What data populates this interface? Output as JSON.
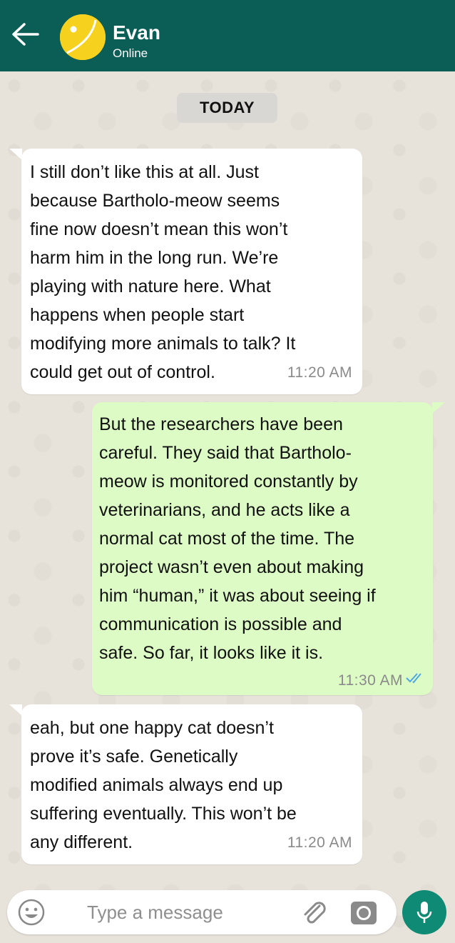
{
  "header": {
    "contact_name": "Evan",
    "status": "Online",
    "background_color": "#0b5e55",
    "avatar_color": "#f6d21f"
  },
  "chat": {
    "date_separator": "TODAY",
    "messages": [
      {
        "direction": "incoming",
        "text": "I still don’t like this at all. Just\nbecause Bartholo-meow seems\nfine now doesn’t mean this won’t\nharm him in the long run. We’re\nplaying with nature here. What\nhappens when people start\nmodifying more animals to talk? It\ncould get out of control.",
        "time": "11:20 AM"
      },
      {
        "direction": "outgoing",
        "text": "But the researchers have been\ncareful. They said that Bartholo-\nmeow is monitored constantly by\nveterinarians, and he acts like a\nnormal cat most of the time. The\nproject wasn’t even about making\nhim “human,” it was about seeing if\ncommunication is possible and\nsafe. So far, it looks like it is.",
        "time": "11:30 AM",
        "read_receipt": "double-check-icon"
      },
      {
        "direction": "incoming",
        "text": "eah, but one happy cat doesn’t\nprove it’s safe. Genetically\nmodified animals always end up\nsuffering eventually. This won’t be\nany different.",
        "time": "11:20 AM"
      }
    ]
  },
  "composer": {
    "placeholder": "Type a message",
    "value": "",
    "icons": [
      "emoji-icon",
      "paperclip-icon",
      "camera-icon",
      "microphone-icon"
    ]
  },
  "colors": {
    "incoming_bubble": "#ffffff",
    "outgoing_bubble": "#ddfbc5",
    "accent": "#0f8a74",
    "read_tick": "#4fa7e6"
  }
}
